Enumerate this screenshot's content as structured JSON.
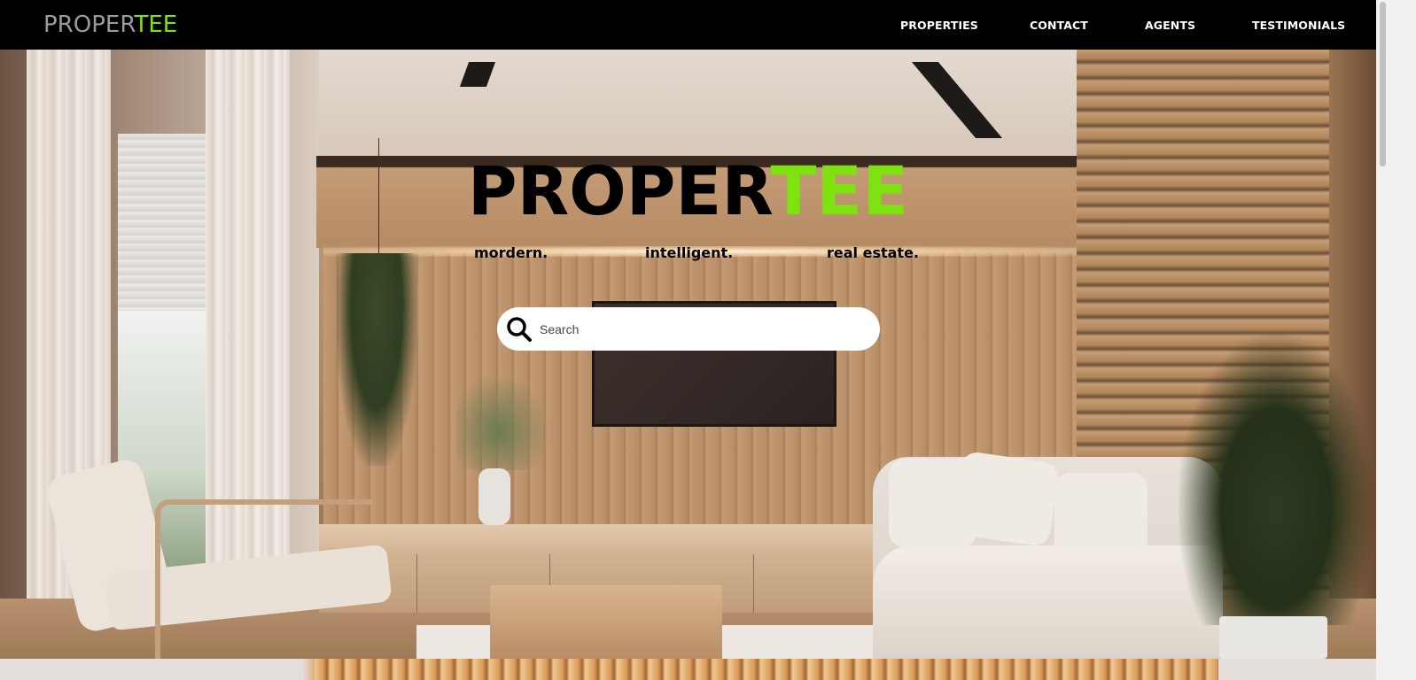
{
  "nav": {
    "brand_part1": "PROPER",
    "brand_part2": "TEE",
    "links": [
      {
        "label": "PROPERTIES"
      },
      {
        "label": "CONTACT"
      },
      {
        "label": "AGENTS"
      },
      {
        "label": "TESTIMONIALS"
      }
    ]
  },
  "hero": {
    "title_part1": "PROPER",
    "title_part2": "TEE",
    "taglines": [
      "mordern.",
      "intelligent.",
      "real estate."
    ],
    "search": {
      "placeholder": "Search",
      "icon": "search-icon"
    }
  },
  "colors": {
    "accent": "#7ee20f",
    "nav_bg": "#000000",
    "brand_gray": "#9a9a9a"
  }
}
